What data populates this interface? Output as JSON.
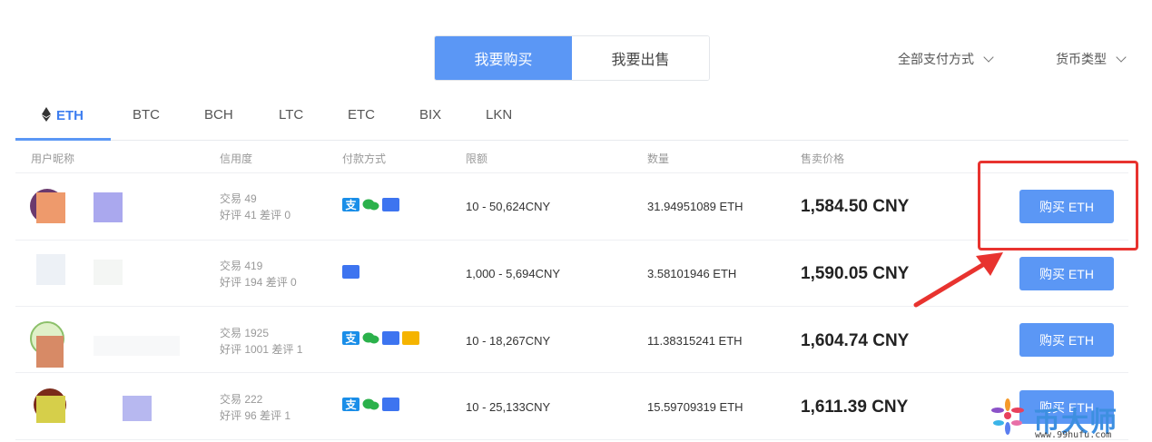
{
  "toggle": {
    "buy": "我要购买",
    "sell": "我要出售"
  },
  "filters": {
    "payment": "全部支付方式",
    "currency": "货币类型"
  },
  "tabs": [
    "ETH",
    "BTC",
    "BCH",
    "LTC",
    "ETC",
    "BIX",
    "LKN"
  ],
  "active_tab": "ETH",
  "columns": {
    "user": "用户昵称",
    "credit": "信用度",
    "payment": "付款方式",
    "limit": "限额",
    "amount": "数量",
    "price": "售卖价格"
  },
  "rows": [
    {
      "trades": "交易 49",
      "reviews": "好评 41 差评 0",
      "limit": "10 - 50,624CNY",
      "amount": "31.94951089 ETH",
      "price": "1,584.50 CNY",
      "button": "购买 ETH",
      "payments": [
        "alipay",
        "wechat",
        "card"
      ]
    },
    {
      "trades": "交易 419",
      "reviews": "好评 194 差评 0",
      "limit": "1,000 - 5,694CNY",
      "amount": "3.58101946 ETH",
      "price": "1,590.05 CNY",
      "button": "购买 ETH",
      "payments": [
        "card"
      ]
    },
    {
      "trades": "交易 1925",
      "reviews": "好评 1001 差评 1",
      "limit": "10 - 18,267CNY",
      "amount": "11.38315241 ETH",
      "price": "1,604.74 CNY",
      "button": "购买 ETH",
      "payments": [
        "alipay",
        "wechat",
        "card",
        "other"
      ]
    },
    {
      "trades": "交易 222",
      "reviews": "好评 96 差评 1",
      "limit": "10 - 25,133CNY",
      "amount": "15.59709319 ETH",
      "price": "1,611.39 CNY",
      "button": "购买 ETH",
      "payments": [
        "alipay",
        "wechat",
        "card"
      ]
    }
  ],
  "watermark": {
    "text": "币大师",
    "url": "www.99hufu.com"
  },
  "colors": {
    "accent": "#5b97f5",
    "annotation": "#e8332f"
  }
}
